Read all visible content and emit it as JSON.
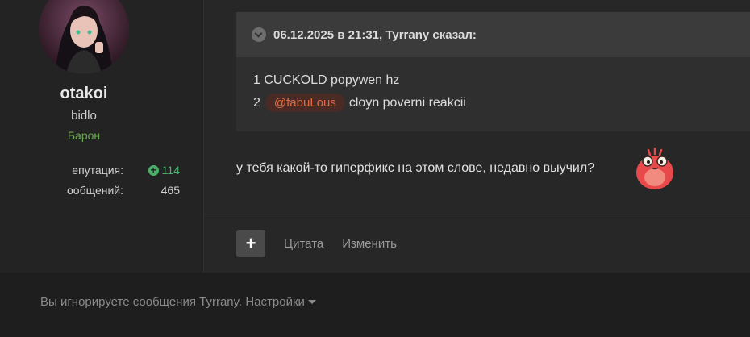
{
  "user": {
    "name": "otakoi",
    "title": "bidlo",
    "rank": "Барон",
    "reputation_label": "епутация:",
    "reputation_value": "114",
    "messages_label": "ообщений:",
    "messages_value": "465"
  },
  "quote": {
    "header": "06.12.2025 в 21:31, Tyrrany сказал:",
    "line1": "1 CUCKOLD popywen hz",
    "line2_num": "2",
    "line2_mention": "@fabuLous",
    "line2_text": "cloyn poverni reakcii"
  },
  "reply": {
    "text": "у тебя какой-то гиперфикс на этом слове, недавно выучил?",
    "emoji_icon": "red-blob-sticker-icon"
  },
  "actions": {
    "plus_icon": "plus-icon",
    "quote_label": "Цитата",
    "edit_label": "Изменить"
  },
  "footer": {
    "ignored_text": "Вы игнорируете сообщения Tyrrany.",
    "settings_label": "Настройки"
  },
  "colors": {
    "accent_green": "#4caf6a",
    "rank_green": "#6aa84f",
    "mention_orange": "#e06a44"
  }
}
